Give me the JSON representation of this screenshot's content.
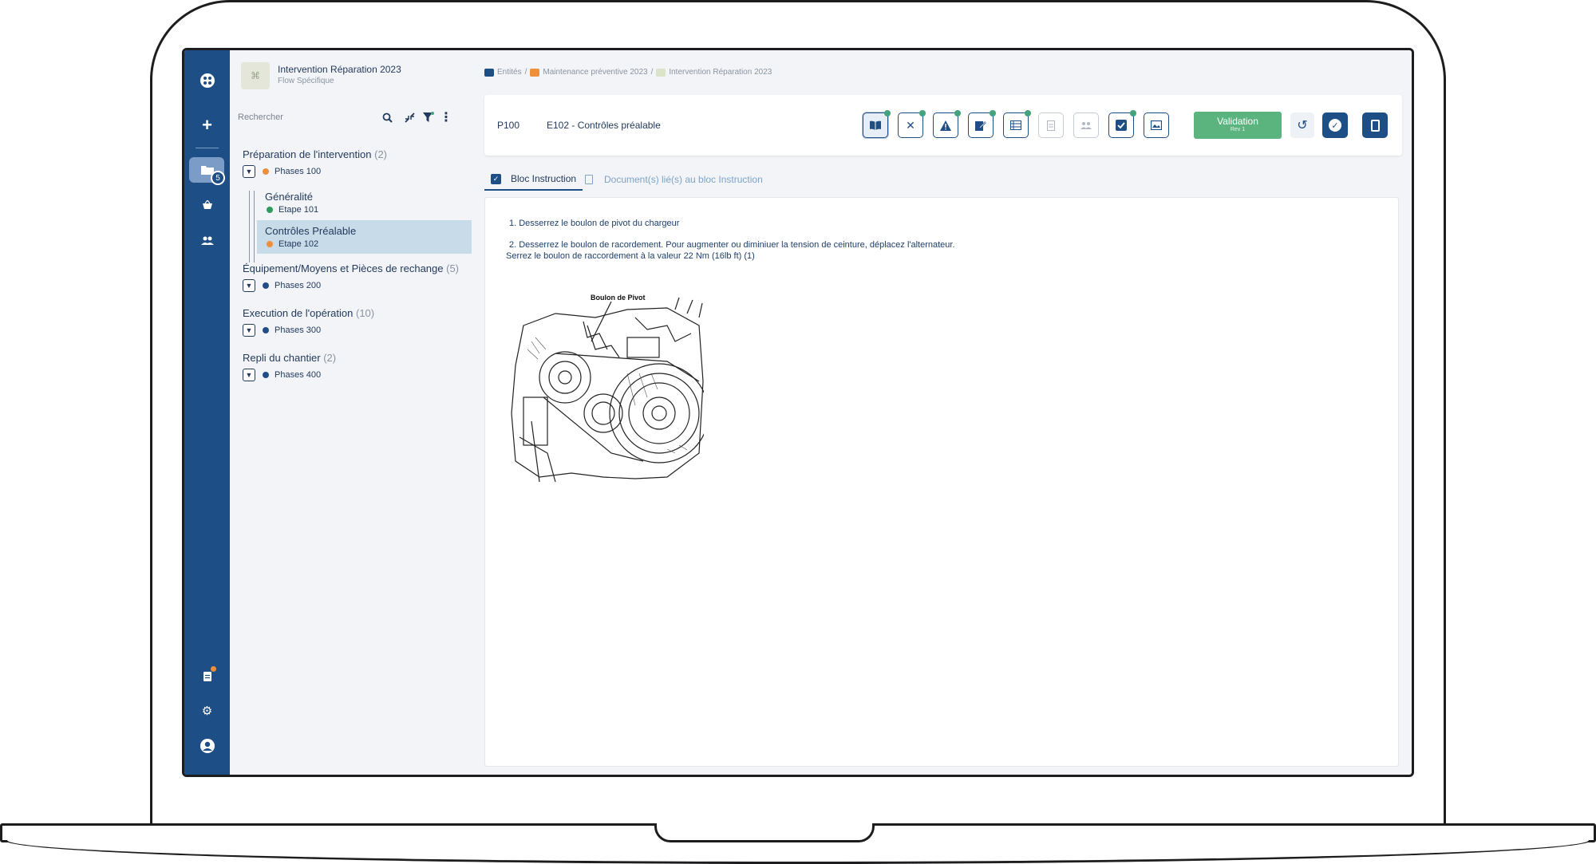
{
  "flow": {
    "title": "Intervention Réparation 2023",
    "subtitle": "Flow Spécifique"
  },
  "rail": {
    "badge": "5",
    "icons": [
      "apps-icon",
      "plus-icon",
      "folder-icon",
      "basket-icon",
      "users-icon",
      "clipboard-icon",
      "gear-icon",
      "account-icon"
    ]
  },
  "search": {
    "placeholder": "Rechercher"
  },
  "tree": {
    "groups": [
      {
        "title": "Préparation de l'intervention",
        "count": "(2)",
        "phase": "Phases 100",
        "color": "#ef8f3a"
      },
      {
        "title": "Équipement/Moyens et Pièces de rechange",
        "count": "(5)",
        "phase": "Phases 200",
        "color": "#1e4e86"
      },
      {
        "title": "Execution de l'opération",
        "count": "(10)",
        "phase": "Phases 300",
        "color": "#1e4e86"
      },
      {
        "title": "Repli du chantier",
        "count": "(2)",
        "phase": "Phases 400",
        "color": "#1e4e86"
      }
    ],
    "steps": [
      {
        "title": "Généralité",
        "label": "Etape 101",
        "color": "#2e9a5e"
      },
      {
        "title": "Contrôles Préalable",
        "label": "Etape 102",
        "color": "#ef8f3a"
      }
    ]
  },
  "breadcrumb": {
    "items": [
      "Entités",
      "Maintenance préventive 2023",
      "Intervention Réparation 2023"
    ],
    "separator": "/"
  },
  "header": {
    "code": "P100",
    "title": "E102 - Contrôles préalable",
    "validation_label": "Validation",
    "validation_rev": "Rev 1"
  },
  "tabs": {
    "instruction": "Bloc Instruction",
    "documents": "Document(s) lié(s) au bloc Instruction"
  },
  "instructions": {
    "line1": "1. Desserrez le boulon de pivot du chargeur",
    "line2": "2. Desserrez le boulon de racordement. Pour augmenter ou diminiuer la tension de ceinture, déplacez l'alternateur.",
    "line3": "Serrez le boulon de raccordement à la valeur 22 Nm (16lb ft) (1)",
    "figure_label": "Boulon de Pivot"
  },
  "colors": {
    "primary": "#1e4e86",
    "validation": "#5bb47e",
    "active_step_bg": "#c7dbe9",
    "orange": "#ef8f3a",
    "green": "#2e9a5e"
  }
}
